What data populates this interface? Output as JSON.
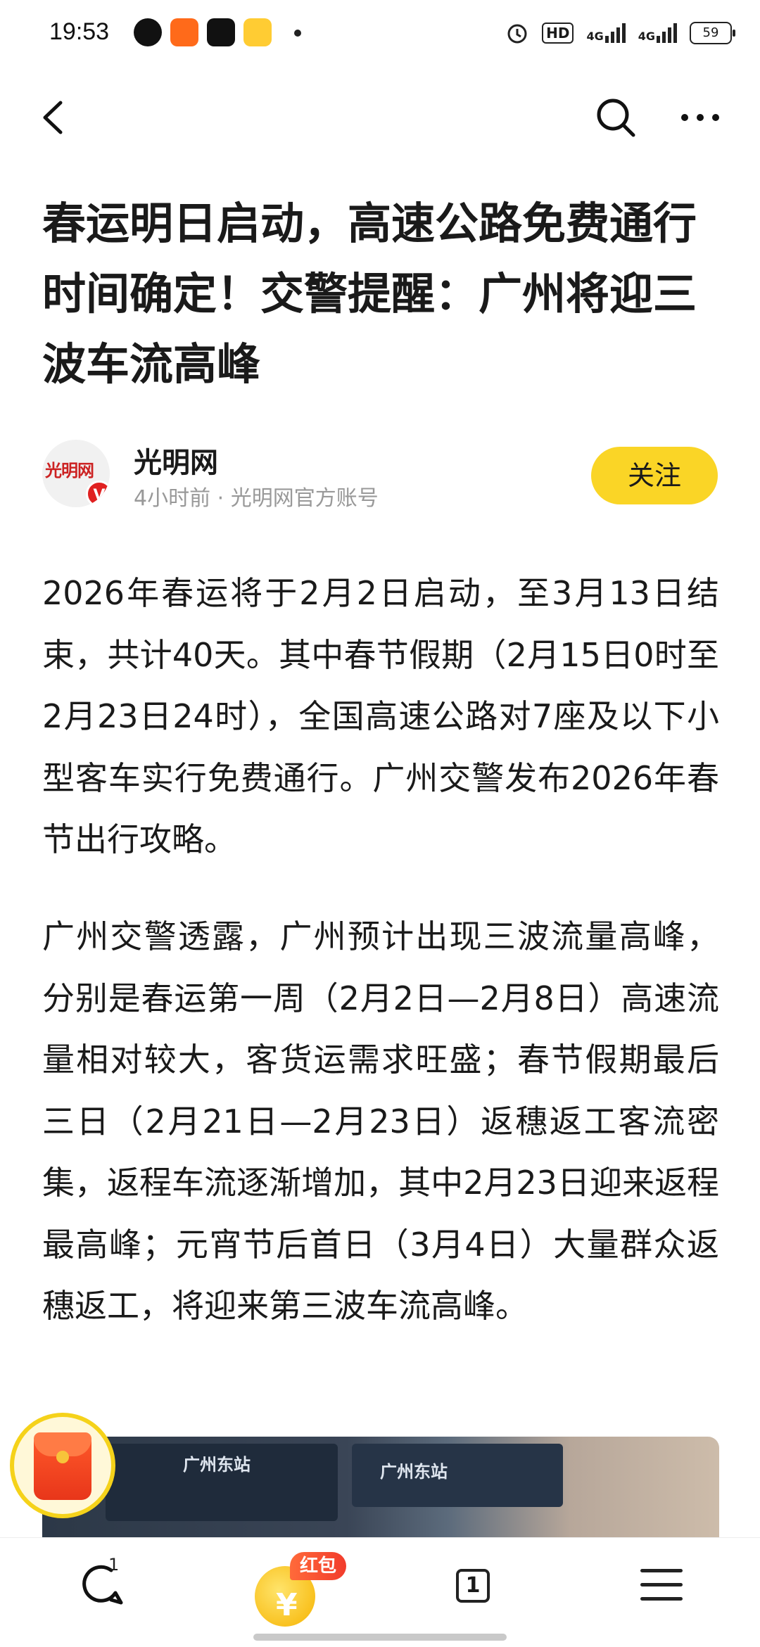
{
  "status_bar": {
    "time": "19:53",
    "apps": [
      "k-app-icon",
      "send-app-icon",
      "tiktok-app-icon",
      "shopping-app-icon"
    ],
    "hd_label": "HD",
    "network1": "4G",
    "network2": "4G",
    "battery": "59"
  },
  "nav": {
    "back_icon": "back-arrow-icon",
    "search_icon": "search-icon",
    "more_icon": "more-icon"
  },
  "article": {
    "title": "春运明日启动，高速公路免费通行时间确定！交警提醒：广州将迎三波车流高峰",
    "author": {
      "name": "光明网",
      "meta": "4小时前 · 光明网官方账号",
      "avatar_text": "光明网",
      "verified": "V"
    },
    "follow_label": "关注",
    "paragraphs": [
      "2026年春运将于2月2日启动，至3月13日结束，共计40天。其中春节假期（2月15日0时至2月23日24时），全国高速公路对7座及以下小型客车实行免费通行。广州交警发布2026年春节出行攻略。",
      "广州交警透露，广州预计出现三波流量高峰，分别是春运第一周（2月2日—2月8日）高速流量相对较大，客货运需求旺盛；春节假期最后三日（2月21日—2月23日）返穗返工客流密集，返程车流逐渐增加，其中2月23日迎来返程最高峰；元宵节后首日（3月4日）大量群众返穗返工，将迎来第三波车流高峰。"
    ],
    "image": {
      "sign1": "广州东站",
      "sign2": "广州东站"
    }
  },
  "bottom_bar": {
    "comment_count": "1",
    "coin_symbol": "¥",
    "coin_tag": "红包",
    "tab_count": "1"
  }
}
